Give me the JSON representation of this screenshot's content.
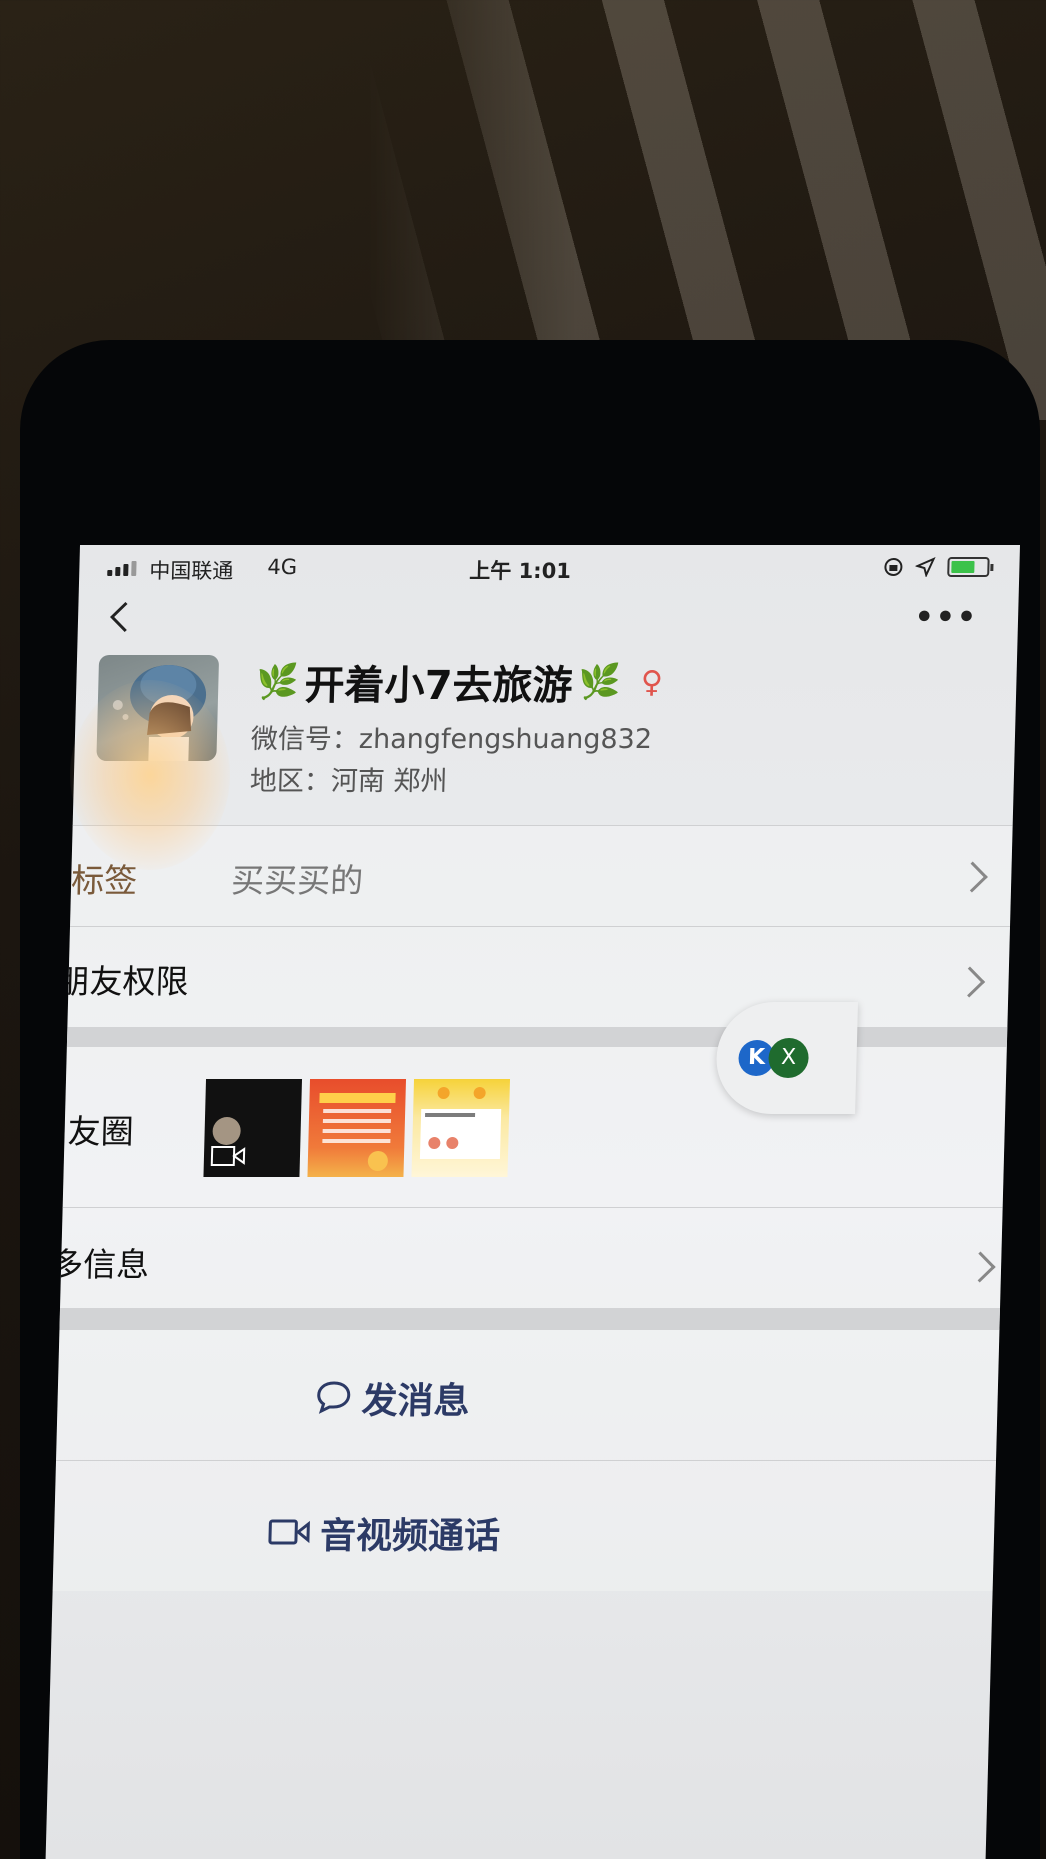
{
  "status_bar": {
    "carrier": "中国联通",
    "network": "4G",
    "time": "上午 1:01"
  },
  "nav": {
    "more_label": "•••"
  },
  "profile": {
    "name": "开着小7去旅游",
    "wechat_id_label": "微信号：",
    "wechat_id": "zhangfengshuang832",
    "region_label": "地区：",
    "region": "河南 郑州"
  },
  "rows": {
    "tags_label": "标签",
    "tags_value": "买买买的",
    "friend_permissions_label": "朋友权限",
    "moments_label": "朋友圈",
    "more_info_label": "更多信息"
  },
  "floating_widget": {
    "k_label": "K",
    "x_label": "X"
  },
  "actions": {
    "send_message_label": "发消息",
    "video_call_label": "音视频通话"
  },
  "colors": {
    "action_text": "#2c3a66",
    "gender_icon": "#e0554d",
    "leaf": "#3b8f2a",
    "battery_fill": "#3cc24a"
  }
}
